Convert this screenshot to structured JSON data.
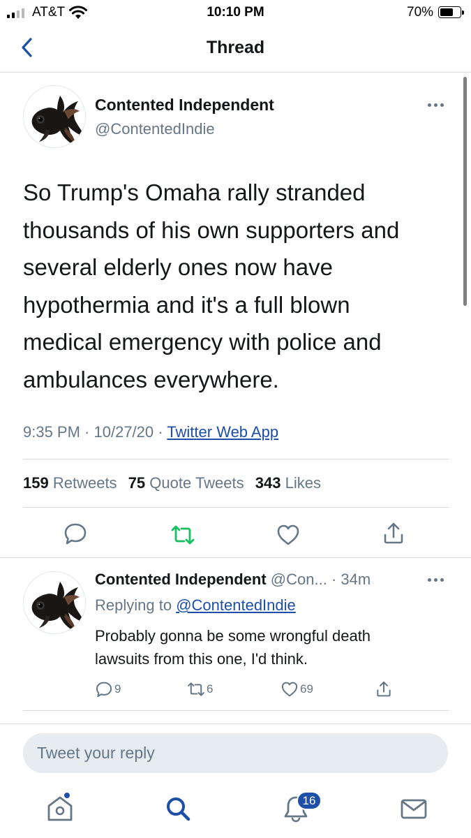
{
  "status_bar": {
    "carrier": "AT&T",
    "time": "10:10 PM",
    "battery_percent": "70%",
    "battery_level": 0.7,
    "signal_bars": 2
  },
  "nav": {
    "title": "Thread",
    "back_icon": "chevron-left-icon"
  },
  "tweet": {
    "author_name": "Contented Independent",
    "author_handle": "@ContentedIndie",
    "text_lines": [
      "So Trump's Omaha rally stranded",
      "thousands of his own supporters and",
      "several elderly ones now have",
      "hypothermia and it's a full blown",
      "medical emergency with police and",
      "ambulances everywhere."
    ],
    "time": "9:35 PM",
    "date": "10/27/20",
    "separator": " · ",
    "source": "Twitter Web App",
    "stats": {
      "retweets_count": "159",
      "retweets_label": "Retweets",
      "quotes_count": "75",
      "quotes_label": "Quote Tweets",
      "likes_count": "343",
      "likes_label": "Likes"
    }
  },
  "reply": {
    "author_name": "Contented Independent",
    "author_handle": "@Con...",
    "age": "· 34m",
    "replying_prefix": "Replying to",
    "replying_to": "@ContentedIndie",
    "text_lines": [
      "Probably gonna be some wrongful death",
      "lawsuits from this one, I'd think."
    ],
    "reply_count": "9",
    "retweet_count": "6",
    "like_count": "69"
  },
  "compose": {
    "placeholder": "Tweet your reply"
  },
  "tab_bar": {
    "notifications_badge": "16"
  },
  "colors": {
    "accent": "#1d4ea8",
    "retweet_green": "#17bf63",
    "secondary_text": "#657786",
    "primary_text": "#14171a"
  }
}
